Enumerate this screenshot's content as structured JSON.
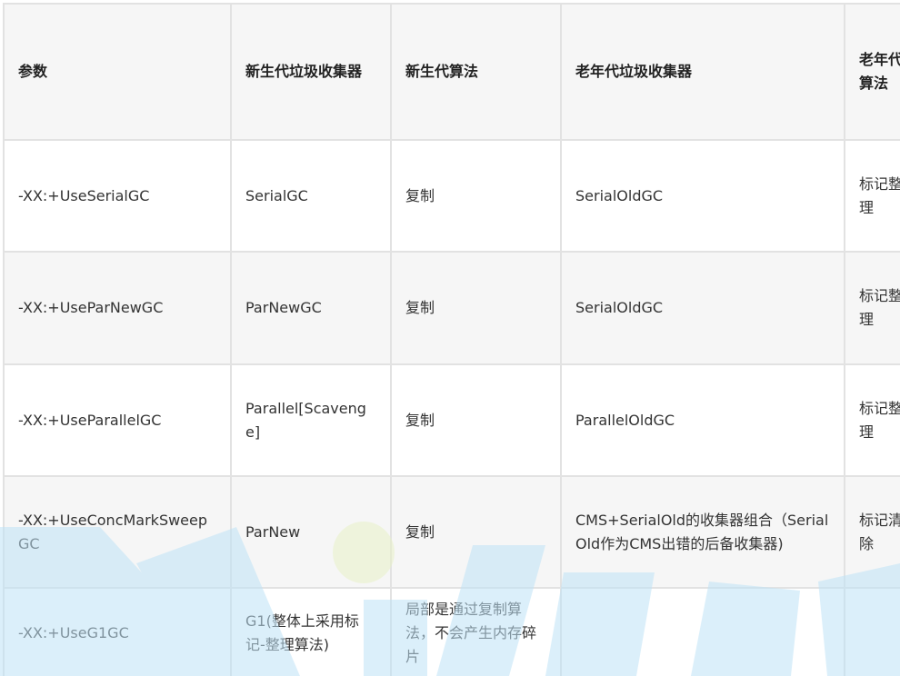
{
  "table": {
    "headers": [
      "参数",
      "新生代垃圾收集器",
      "新生代算法",
      "老年代垃圾收集器",
      "老年代算法"
    ],
    "rows": [
      [
        "-XX:+UseSerialGC",
        "SerialGC",
        "复制",
        "SerialOldGC",
        "标记整理"
      ],
      [
        "-XX:+UseParNewGC",
        "ParNewGC",
        "复制",
        "SerialOldGC",
        "标记整理"
      ],
      [
        "-XX:+UseParallelGC",
        "Parallel[Scavenge]",
        "复制",
        "ParallelOldGC",
        "标记整理"
      ],
      [
        "-XX:+UseConcMarkSweepGC",
        "ParNew",
        "复制",
        "CMS+SerialOld的收集器组合（Serial Old作为CMS出错的后备收集器)",
        "标记清除"
      ],
      [
        "-XX:+UseG1GC",
        "G1(整体上采用标记-整理算法)",
        "局部是通过复制算法，不会产生内存碎片",
        "",
        ""
      ]
    ]
  },
  "colors": {
    "border": "#e2e2e2",
    "header_bg": "#f6f6f6",
    "text": "#333333",
    "watermark": "#bfe3f7"
  }
}
